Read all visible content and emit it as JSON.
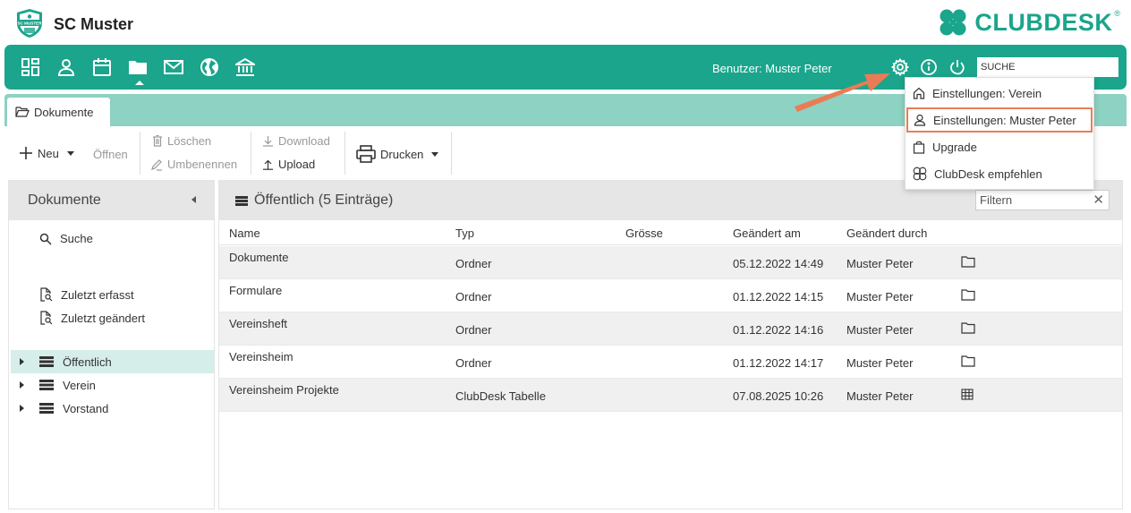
{
  "header": {
    "club_name": "SC Muster",
    "club_logo_text": "SC MUSTER",
    "brand_name": "CLUBDESK",
    "brand_reg": "®"
  },
  "nav": {
    "items": [
      "dashboard",
      "members",
      "calendar",
      "documents",
      "mail",
      "website",
      "finance"
    ],
    "active": "documents",
    "user_label": "Benutzer: Muster Peter",
    "search_placeholder": "SUCHE"
  },
  "tabs": [
    {
      "label": "Dokumente"
    }
  ],
  "toolbar": {
    "new_label": "Neu",
    "open_label": "Öffnen",
    "delete_label": "Löschen",
    "rename_label": "Umbenennen",
    "download_label": "Download",
    "upload_label": "Upload",
    "print_label": "Drucken"
  },
  "sidebar": {
    "title": "Dokumente",
    "search_label": "Suche",
    "recent_created": "Zuletzt erfasst",
    "recent_changed": "Zuletzt geändert",
    "tree": [
      {
        "label": "Öffentlich",
        "selected": true
      },
      {
        "label": "Verein",
        "selected": false
      },
      {
        "label": "Vorstand",
        "selected": false
      }
    ]
  },
  "main": {
    "title": "Öffentlich (5 Einträge)",
    "filter_placeholder": "Filtern",
    "columns": [
      "Name",
      "Typ",
      "Grösse",
      "Geändert am",
      "Geändert durch"
    ],
    "rows": [
      {
        "name": "Dokumente",
        "type": "Ordner",
        "size": "",
        "changed_at": "05.12.2022 14:49",
        "changed_by": "Muster Peter",
        "icon": "folder-icon"
      },
      {
        "name": "Formulare",
        "type": "Ordner",
        "size": "",
        "changed_at": "01.12.2022 14:15",
        "changed_by": "Muster Peter",
        "icon": "folder-icon"
      },
      {
        "name": "Vereinsheft",
        "type": "Ordner",
        "size": "",
        "changed_at": "01.12.2022 14:16",
        "changed_by": "Muster Peter",
        "icon": "folder-icon"
      },
      {
        "name": "Vereinsheim",
        "type": "Ordner",
        "size": "",
        "changed_at": "01.12.2022 14:17",
        "changed_by": "Muster Peter",
        "icon": "folder-icon"
      },
      {
        "name": "Vereinsheim Projekte",
        "type": "ClubDesk Tabelle",
        "size": "",
        "changed_at": "07.08.2025 10:26",
        "changed_by": "Muster Peter",
        "icon": "table-icon"
      }
    ]
  },
  "settings_menu": {
    "items": [
      {
        "label": "Einstellungen: Verein",
        "icon": "home-icon"
      },
      {
        "label": "Einstellungen: Muster Peter",
        "icon": "user-icon",
        "highlighted": true
      },
      {
        "label": "Upgrade",
        "icon": "shopping-bag-icon"
      },
      {
        "label": "ClubDesk empfehlen",
        "icon": "clover-icon"
      }
    ]
  },
  "colors": {
    "brand": "#1aa58c",
    "tabstrip": "#8dd2c3",
    "highlight": "#ea7c55",
    "selected_tree": "#d6eeea"
  }
}
